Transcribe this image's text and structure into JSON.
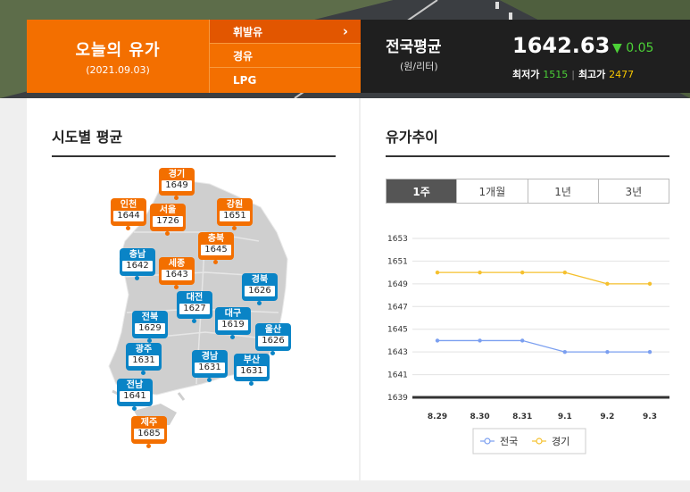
{
  "header": {
    "today_title": "오늘의 유가",
    "today_date": "(2021.09.03)",
    "fuel_menu": [
      {
        "label": "휘발유",
        "active": true
      },
      {
        "label": "경유",
        "active": false
      },
      {
        "label": "LPG",
        "active": false
      }
    ],
    "arrow": "›",
    "national_title": "전국평균",
    "national_unit": "(원/리터)",
    "national_price": "1642.63",
    "change_symbol": "▼",
    "change_value": "0.05",
    "min_label": "최저가",
    "min_value": "1515",
    "sep": "|",
    "max_label": "최고가",
    "max_value": "2477"
  },
  "regional": {
    "title": "시도별 평균",
    "regions": [
      {
        "name": "경기",
        "value": "1649",
        "color": "orange"
      },
      {
        "name": "인천",
        "value": "1644",
        "color": "orange"
      },
      {
        "name": "서울",
        "value": "1726",
        "color": "orange"
      },
      {
        "name": "강원",
        "value": "1651",
        "color": "orange"
      },
      {
        "name": "충북",
        "value": "1645",
        "color": "orange"
      },
      {
        "name": "충남",
        "value": "1642",
        "color": "blue"
      },
      {
        "name": "세종",
        "value": "1643",
        "color": "orange"
      },
      {
        "name": "경북",
        "value": "1626",
        "color": "blue"
      },
      {
        "name": "대전",
        "value": "1627",
        "color": "blue"
      },
      {
        "name": "전북",
        "value": "1629",
        "color": "blue"
      },
      {
        "name": "대구",
        "value": "1619",
        "color": "blue"
      },
      {
        "name": "울산",
        "value": "1626",
        "color": "blue"
      },
      {
        "name": "광주",
        "value": "1631",
        "color": "blue"
      },
      {
        "name": "경남",
        "value": "1631",
        "color": "blue"
      },
      {
        "name": "부산",
        "value": "1631",
        "color": "blue"
      },
      {
        "name": "전남",
        "value": "1641",
        "color": "blue"
      },
      {
        "name": "제주",
        "value": "1685",
        "color": "orange"
      }
    ]
  },
  "trend": {
    "title": "유가추이",
    "tabs": [
      {
        "label": "1주",
        "active": true
      },
      {
        "label": "1개월",
        "active": false
      },
      {
        "label": "1년",
        "active": false
      },
      {
        "label": "3년",
        "active": false
      }
    ]
  },
  "colors": {
    "orange": "#f36f00",
    "blue": "#0a84c6",
    "nation_line": "#7b9ff0",
    "gyeonggi_line": "#f5c02d"
  },
  "chart_data": {
    "type": "line",
    "categories": [
      "8.29",
      "8.30",
      "8.31",
      "9.1",
      "9.2",
      "9.3"
    ],
    "series": [
      {
        "name": "전국",
        "values": [
          1644,
          1644,
          1644,
          1643,
          1643,
          1643
        ]
      },
      {
        "name": "경기",
        "values": [
          1650,
          1650,
          1650,
          1650,
          1649,
          1649
        ]
      }
    ],
    "yticks": [
      1639,
      1641,
      1643,
      1645,
      1647,
      1649,
      1651,
      1653
    ],
    "ylim": [
      1639,
      1653
    ],
    "legend": "bottom",
    "grid": true
  }
}
